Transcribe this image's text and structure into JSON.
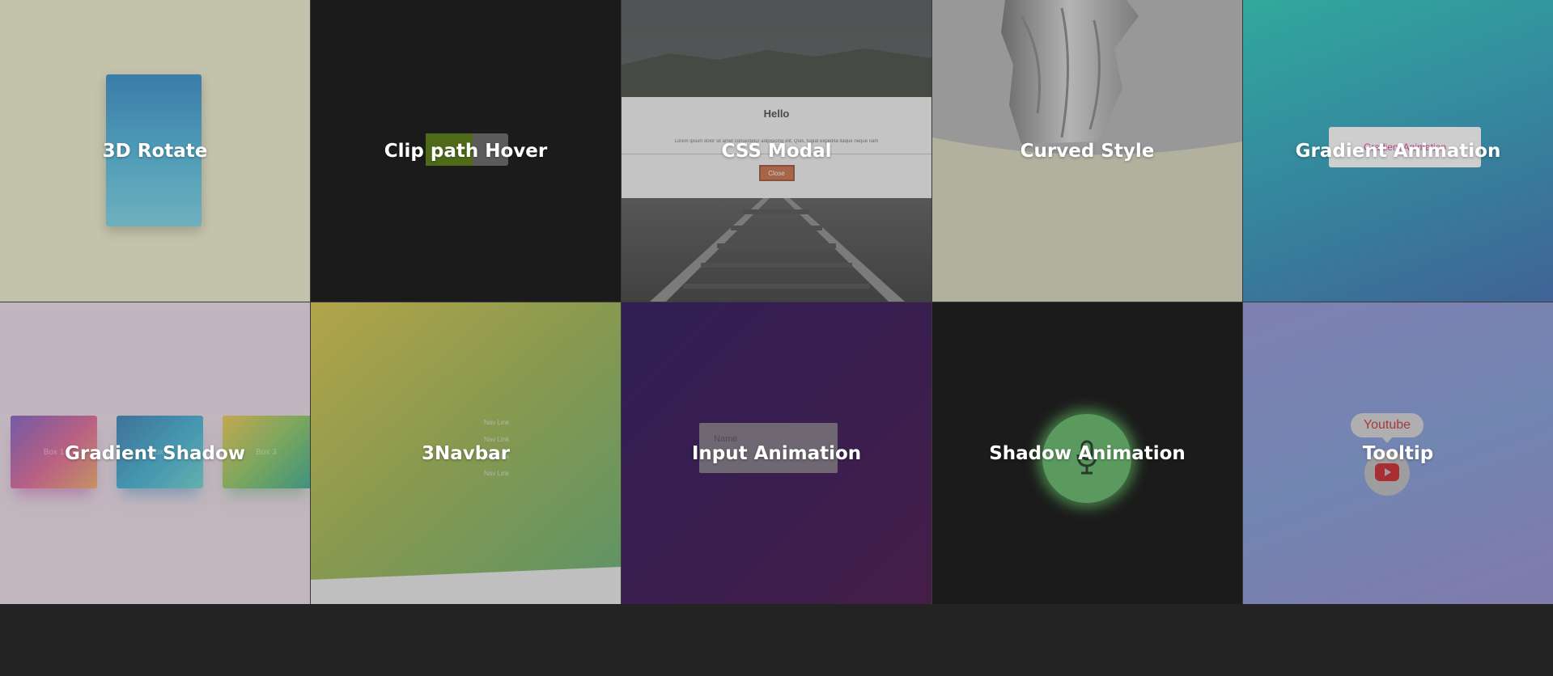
{
  "tiles": [
    {
      "title": "3D Rotate"
    },
    {
      "title": "Clip path Hover"
    },
    {
      "title": "CSS Modal",
      "modal": {
        "heading": "Hello",
        "body": "Lorem ipsum dolor sit amet consectetur adipisicing elit. Quis, fugiat expedita itaque neque nam",
        "button": "Close"
      }
    },
    {
      "title": "Curved Style"
    },
    {
      "title": "Gradient Animation",
      "hidden_text": "Gradient Animation"
    },
    {
      "title": "Gradient Shadow",
      "boxes": [
        "Box 1",
        "Box 2",
        "Box 3"
      ]
    },
    {
      "title": "3Navbar",
      "links": [
        "Nav Link",
        "Nav Link",
        "Nav Link",
        "Nav Link"
      ]
    },
    {
      "title": "Input Animation",
      "input_placeholder": "Name"
    },
    {
      "title": "Shadow Animation"
    },
    {
      "title": "Tooltip",
      "tooltip": "Youtube"
    }
  ],
  "colors": {
    "background": "#232323",
    "accent_green": "#4caf50",
    "youtube_red": "#ff0000"
  }
}
